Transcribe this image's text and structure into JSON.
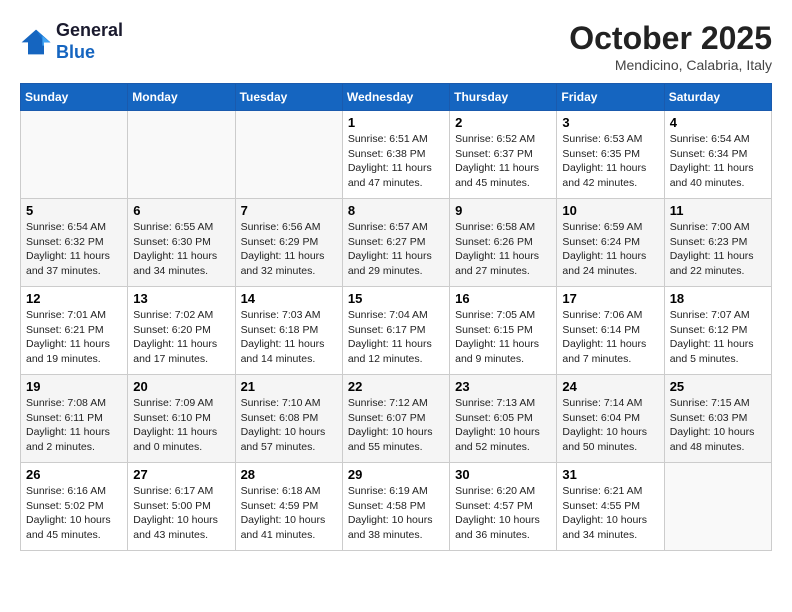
{
  "logo": {
    "line1": "General",
    "line2": "Blue"
  },
  "header": {
    "month": "October 2025",
    "location": "Mendicino, Calabria, Italy"
  },
  "weekdays": [
    "Sunday",
    "Monday",
    "Tuesday",
    "Wednesday",
    "Thursday",
    "Friday",
    "Saturday"
  ],
  "weeks": [
    [
      {
        "day": "",
        "info": ""
      },
      {
        "day": "",
        "info": ""
      },
      {
        "day": "",
        "info": ""
      },
      {
        "day": "1",
        "info": "Sunrise: 6:51 AM\nSunset: 6:38 PM\nDaylight: 11 hours\nand 47 minutes."
      },
      {
        "day": "2",
        "info": "Sunrise: 6:52 AM\nSunset: 6:37 PM\nDaylight: 11 hours\nand 45 minutes."
      },
      {
        "day": "3",
        "info": "Sunrise: 6:53 AM\nSunset: 6:35 PM\nDaylight: 11 hours\nand 42 minutes."
      },
      {
        "day": "4",
        "info": "Sunrise: 6:54 AM\nSunset: 6:34 PM\nDaylight: 11 hours\nand 40 minutes."
      }
    ],
    [
      {
        "day": "5",
        "info": "Sunrise: 6:54 AM\nSunset: 6:32 PM\nDaylight: 11 hours\nand 37 minutes."
      },
      {
        "day": "6",
        "info": "Sunrise: 6:55 AM\nSunset: 6:30 PM\nDaylight: 11 hours\nand 34 minutes."
      },
      {
        "day": "7",
        "info": "Sunrise: 6:56 AM\nSunset: 6:29 PM\nDaylight: 11 hours\nand 32 minutes."
      },
      {
        "day": "8",
        "info": "Sunrise: 6:57 AM\nSunset: 6:27 PM\nDaylight: 11 hours\nand 29 minutes."
      },
      {
        "day": "9",
        "info": "Sunrise: 6:58 AM\nSunset: 6:26 PM\nDaylight: 11 hours\nand 27 minutes."
      },
      {
        "day": "10",
        "info": "Sunrise: 6:59 AM\nSunset: 6:24 PM\nDaylight: 11 hours\nand 24 minutes."
      },
      {
        "day": "11",
        "info": "Sunrise: 7:00 AM\nSunset: 6:23 PM\nDaylight: 11 hours\nand 22 minutes."
      }
    ],
    [
      {
        "day": "12",
        "info": "Sunrise: 7:01 AM\nSunset: 6:21 PM\nDaylight: 11 hours\nand 19 minutes."
      },
      {
        "day": "13",
        "info": "Sunrise: 7:02 AM\nSunset: 6:20 PM\nDaylight: 11 hours\nand 17 minutes."
      },
      {
        "day": "14",
        "info": "Sunrise: 7:03 AM\nSunset: 6:18 PM\nDaylight: 11 hours\nand 14 minutes."
      },
      {
        "day": "15",
        "info": "Sunrise: 7:04 AM\nSunset: 6:17 PM\nDaylight: 11 hours\nand 12 minutes."
      },
      {
        "day": "16",
        "info": "Sunrise: 7:05 AM\nSunset: 6:15 PM\nDaylight: 11 hours\nand 9 minutes."
      },
      {
        "day": "17",
        "info": "Sunrise: 7:06 AM\nSunset: 6:14 PM\nDaylight: 11 hours\nand 7 minutes."
      },
      {
        "day": "18",
        "info": "Sunrise: 7:07 AM\nSunset: 6:12 PM\nDaylight: 11 hours\nand 5 minutes."
      }
    ],
    [
      {
        "day": "19",
        "info": "Sunrise: 7:08 AM\nSunset: 6:11 PM\nDaylight: 11 hours\nand 2 minutes."
      },
      {
        "day": "20",
        "info": "Sunrise: 7:09 AM\nSunset: 6:10 PM\nDaylight: 11 hours\nand 0 minutes."
      },
      {
        "day": "21",
        "info": "Sunrise: 7:10 AM\nSunset: 6:08 PM\nDaylight: 10 hours\nand 57 minutes."
      },
      {
        "day": "22",
        "info": "Sunrise: 7:12 AM\nSunset: 6:07 PM\nDaylight: 10 hours\nand 55 minutes."
      },
      {
        "day": "23",
        "info": "Sunrise: 7:13 AM\nSunset: 6:05 PM\nDaylight: 10 hours\nand 52 minutes."
      },
      {
        "day": "24",
        "info": "Sunrise: 7:14 AM\nSunset: 6:04 PM\nDaylight: 10 hours\nand 50 minutes."
      },
      {
        "day": "25",
        "info": "Sunrise: 7:15 AM\nSunset: 6:03 PM\nDaylight: 10 hours\nand 48 minutes."
      }
    ],
    [
      {
        "day": "26",
        "info": "Sunrise: 6:16 AM\nSunset: 5:02 PM\nDaylight: 10 hours\nand 45 minutes."
      },
      {
        "day": "27",
        "info": "Sunrise: 6:17 AM\nSunset: 5:00 PM\nDaylight: 10 hours\nand 43 minutes."
      },
      {
        "day": "28",
        "info": "Sunrise: 6:18 AM\nSunset: 4:59 PM\nDaylight: 10 hours\nand 41 minutes."
      },
      {
        "day": "29",
        "info": "Sunrise: 6:19 AM\nSunset: 4:58 PM\nDaylight: 10 hours\nand 38 minutes."
      },
      {
        "day": "30",
        "info": "Sunrise: 6:20 AM\nSunset: 4:57 PM\nDaylight: 10 hours\nand 36 minutes."
      },
      {
        "day": "31",
        "info": "Sunrise: 6:21 AM\nSunset: 4:55 PM\nDaylight: 10 hours\nand 34 minutes."
      },
      {
        "day": "",
        "info": ""
      }
    ]
  ]
}
